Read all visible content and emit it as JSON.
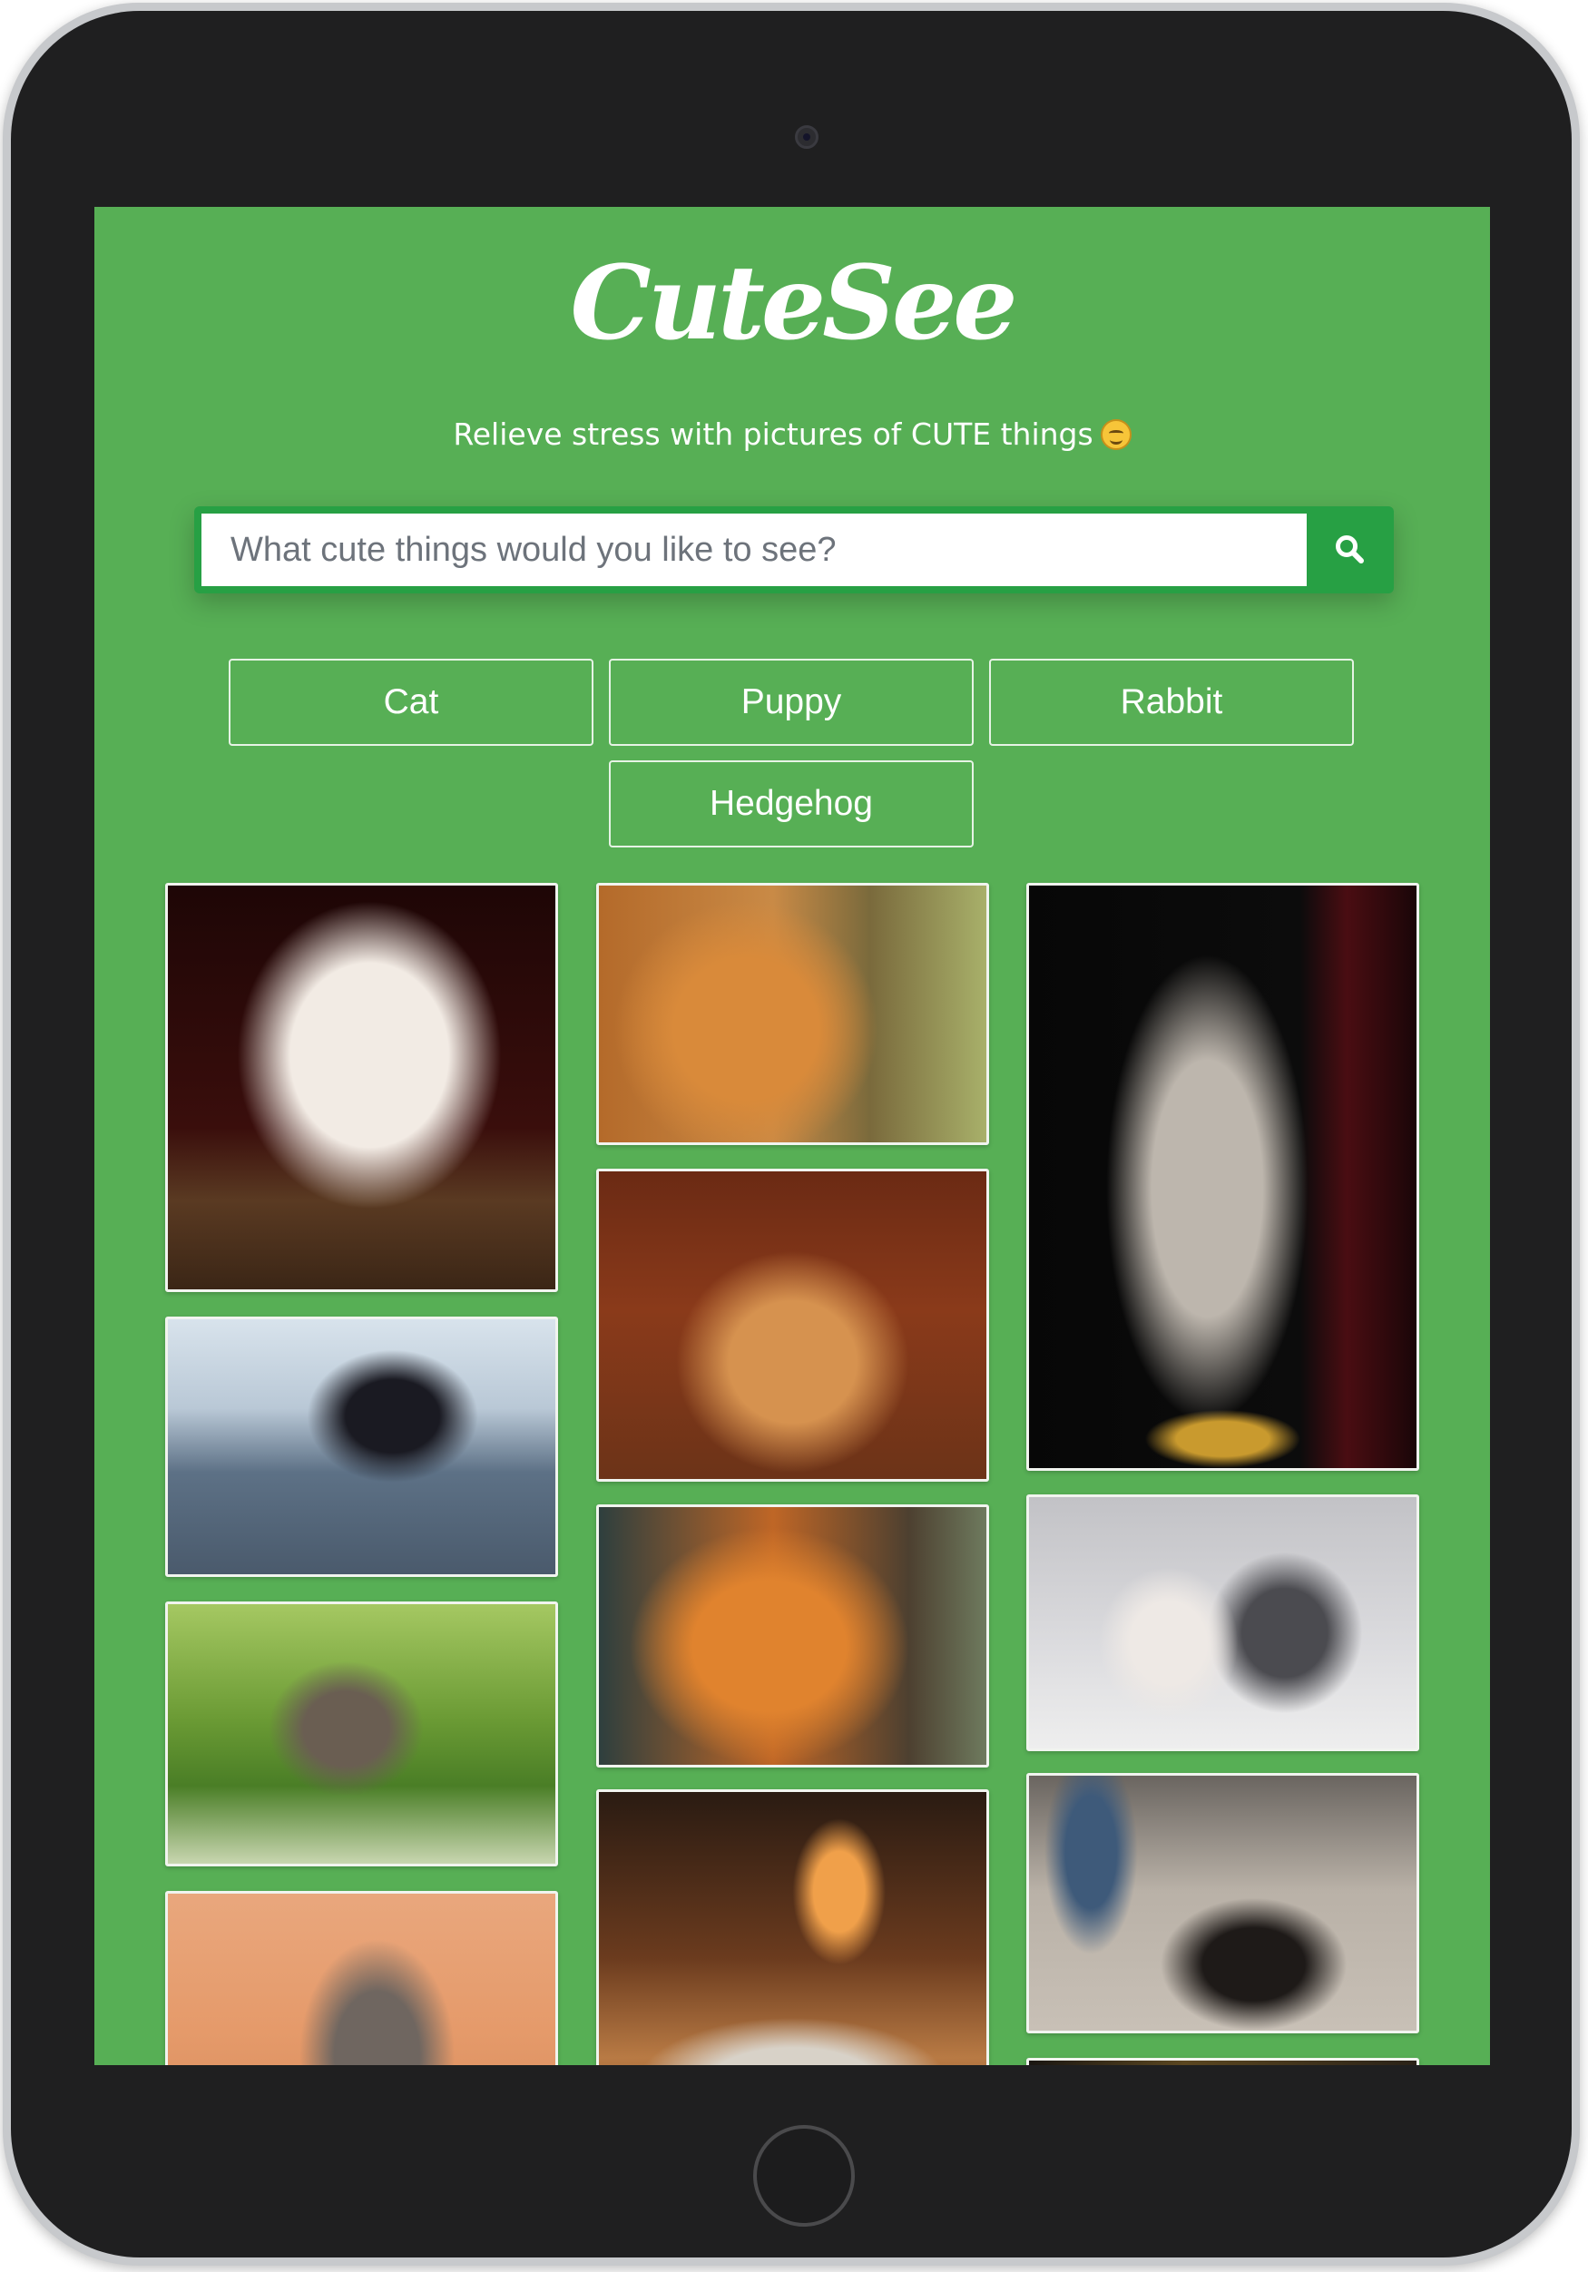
{
  "app": {
    "logo": "CuteSee",
    "tagline": "Relieve stress with pictures of CUTE things"
  },
  "search": {
    "placeholder": "What cute things would you like to see?",
    "button_icon": "search-icon"
  },
  "filters": [
    "Cat",
    "Puppy",
    "Rabbit",
    "Hedgehog"
  ],
  "colors": {
    "background": "#57af55",
    "search_accent": "#27a044",
    "text": "#ffffff"
  },
  "photos": [
    "white-kitten-photo",
    "orange-cat-net-photo",
    "tabby-white-cat-sitting-photo",
    "black-white-kitten-flower-photo",
    "orange-kitten-butterfly-photo",
    "white-gray-kittens-photo",
    "tabby-kitten-daisies-photo",
    "orange-cat-winking-photo",
    "kitten-guitar-case-photo",
    "scottish-fold-kitten-photo",
    "goldfish-bowl-cat-photo",
    "dark-partial-photo"
  ]
}
